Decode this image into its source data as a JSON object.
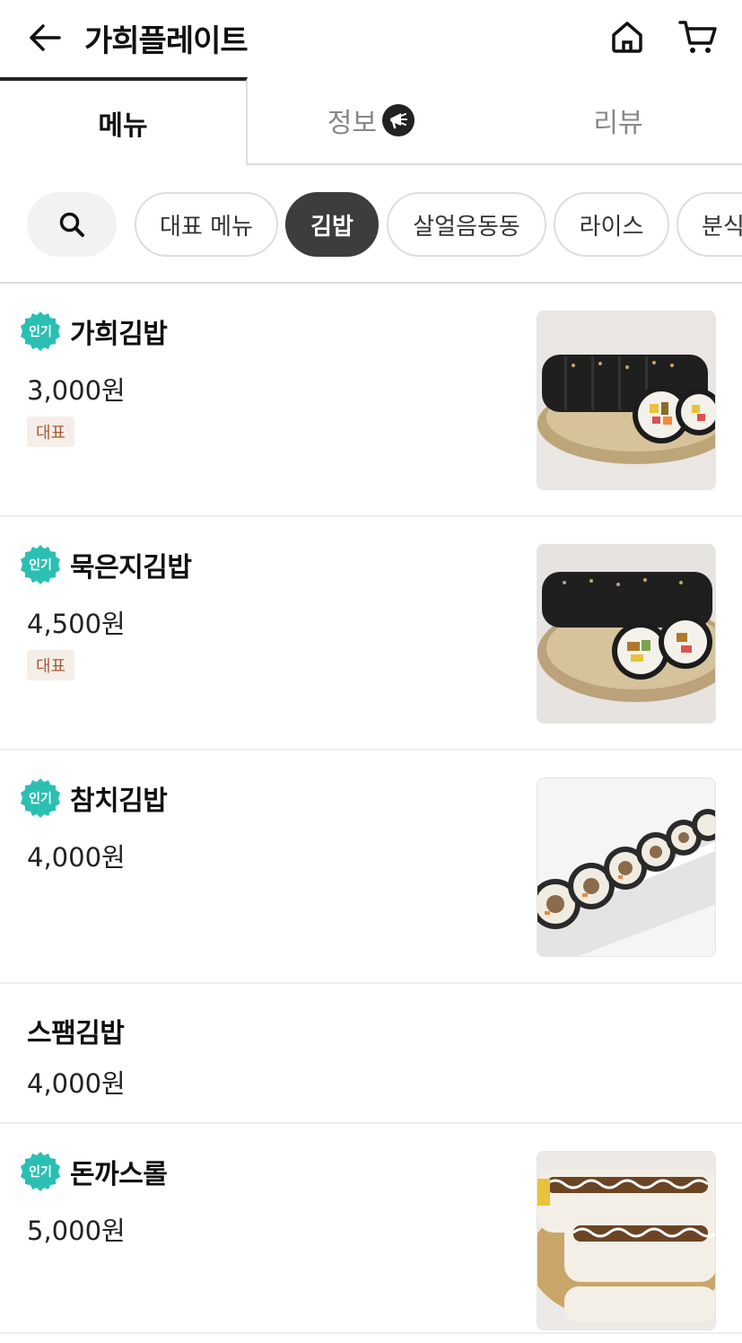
{
  "header": {
    "title": "가희플레이트",
    "back_icon": "arrow-left-icon",
    "home_icon": "home-icon",
    "cart_icon": "cart-icon"
  },
  "tabs": [
    {
      "label": "메뉴",
      "active": true
    },
    {
      "label": "정보",
      "active": false
    },
    {
      "label": "리뷰",
      "active": false
    }
  ],
  "categories": [
    {
      "label": "대표 메뉴",
      "active": false
    },
    {
      "label": "김밥",
      "active": true
    },
    {
      "label": "살얼음동동",
      "active": false
    },
    {
      "label": "라이스",
      "active": false
    },
    {
      "label": "분식",
      "active": false
    }
  ],
  "popular_badge": "인기",
  "rep_tag": "대표",
  "menu_items": [
    {
      "name": "가희김밥",
      "price": "3,000원",
      "popular": true,
      "rep": true,
      "image": "kimbap-photo"
    },
    {
      "name": "묵은지김밥",
      "price": "4,500원",
      "popular": true,
      "rep": true,
      "image": "kimbap-photo"
    },
    {
      "name": "참치김밥",
      "price": "4,000원",
      "popular": true,
      "rep": false,
      "image": "tuna-kimbap-photo"
    },
    {
      "name": "스팸김밥",
      "price": "4,000원",
      "popular": false,
      "rep": false,
      "image": null
    },
    {
      "name": "돈까스롤",
      "price": "5,000원",
      "popular": true,
      "rep": false,
      "image": "donkatsu-roll-photo"
    }
  ],
  "colors": {
    "accent_popular": "#2bbfb3",
    "rep_tag_bg": "#f5eee8",
    "rep_tag_text": "#a55b3a",
    "active_chip": "#3d3d3d"
  }
}
